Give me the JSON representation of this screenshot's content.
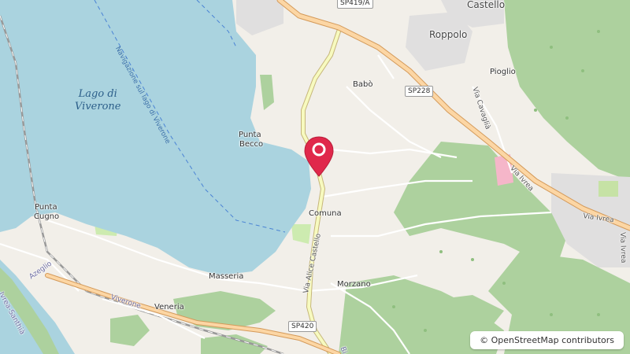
{
  "colors": {
    "water": "#aad3df",
    "land": "#f2efe9",
    "forest": "#add19e",
    "motorway_orange": "#fcd6a4",
    "secondary_yellow": "#f7fabf",
    "marker_red": "#e0284b"
  },
  "marker": {
    "icon": "map-pin-icon"
  },
  "labels": {
    "lake": "Lago di Viverone",
    "lake_line1": "Lago di",
    "lake_line2": "Viverone",
    "navigation": "Navigazione sul lago di Viverone",
    "punta_becco_1": "Punta",
    "punta_becco_2": "Becco",
    "punta_cugno_1": "Punta",
    "punta_cugno_2": "Cugno",
    "castello": "Castello",
    "roppolo": "Roppolo",
    "babo": "Babò",
    "pioglio": "Pioglio",
    "via_cavaglia": "Via Cavaglià",
    "via_ivrea_1": "Via Ivrea",
    "via_ivrea_2": "Via Ivrea",
    "via_ivrea_3": "Via Ivrea",
    "comuna": "Comuna",
    "via_alice_castello": "Via Alice Castello",
    "masseria": "Masseria",
    "morzano": "Morzano",
    "viverone": "Viverone",
    "veneria": "Veneria",
    "azeglio": "Azeglio",
    "ivrea_santhia": "Ivrea-Santhià",
    "bi": "Bi"
  },
  "shields": {
    "sp419a": "SP419/A",
    "sp228": "SP228",
    "sp420": "SP420"
  },
  "attribution": "© OpenStreetMap contributors"
}
